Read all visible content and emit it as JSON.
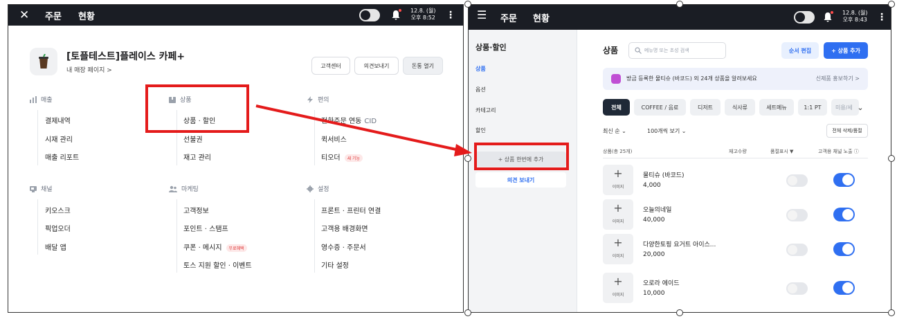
{
  "left_screen": {
    "topbar": {
      "order_label": "주문",
      "status_label": "현황",
      "date": "12.8. (월)",
      "time": "오후 8:52"
    },
    "store": {
      "name": "[토플테스트]플레이스 카페+",
      "sub_link": "내 매장 페이지 >"
    },
    "buttons": {
      "support": "고객센터",
      "feedback": "의견보내기",
      "open_drawer": "돈통 열기"
    },
    "categories": [
      {
        "title": "매출",
        "icon": "bar-chart-icon",
        "items": [
          "결제내역",
          "시재 관리",
          "매출 리포트"
        ]
      },
      {
        "title": "상품",
        "icon": "box-icon",
        "items": [
          "상품 · 할인",
          "선불권",
          "재고 관리"
        ]
      },
      {
        "title": "편의",
        "icon": "lightning-icon",
        "items": [
          "전화주문 연동",
          "퀵서비스",
          "티오더"
        ]
      },
      {
        "title": "채널",
        "icon": "kiosk-icon",
        "items": [
          "키오스크",
          "픽업오더",
          "배달 앱"
        ]
      },
      {
        "title": "마케팅",
        "icon": "people-icon",
        "items": [
          "고객정보",
          "포인트 · 스탬프",
          "쿠폰 · 메시지",
          "토스 지원 할인 · 이벤트"
        ]
      },
      {
        "title": "설정",
        "icon": "gear-icon",
        "items": [
          "프론트 · 프린터 연결",
          "고객용 배경화면",
          "영수증 · 주문서",
          "기타 설정"
        ]
      }
    ],
    "cid_label": "CID",
    "new_badge": "새 기능",
    "free_badge": "무료혜택"
  },
  "right_screen": {
    "topbar": {
      "order_label": "주문",
      "status_label": "현황",
      "date": "12.8. (월)",
      "time": "오후 8:43"
    },
    "sidebar": {
      "title": "상품·할인",
      "items": [
        "상품",
        "옵션",
        "카테고리",
        "할인"
      ],
      "add_bulk": "+ 상품 한번에 추가",
      "feedback": "의견 보내기"
    },
    "main": {
      "title": "상품",
      "search_placeholder": "메뉴명 또는 초성 검색",
      "order_edit": "순서 편집",
      "add_product": "+ 상품 추가",
      "promo_text": "방금 등록한 물티슈 (바코드) 외 24개 상품을 알려보세요",
      "promo_link": "신제품 홍보하기 >",
      "chips": [
        "전체",
        "COFFEE / 음료",
        "디저트",
        "식사류",
        "세트메뉴",
        "1:1 PT",
        "미용/세"
      ],
      "sort": "최신 순 ⌄",
      "page_size": "100개씩 보기 ⌄",
      "bulk_delete": "전체 삭제/품절",
      "headers": {
        "product_count": "상품(총 25개)",
        "stock": "재고수량",
        "soldout": "품절표시",
        "channel": "고객용 채널 노출"
      },
      "image_label": "이미지",
      "products": [
        {
          "name": "물티슈 (바코드)",
          "price": "4,000"
        },
        {
          "name": "오늘의네일",
          "price": "40,000"
        },
        {
          "name": "다양한토핑 요거트 아이스...",
          "price": "20,000"
        },
        {
          "name": "오로라 에이드",
          "price": "10,000"
        }
      ]
    }
  },
  "colors": {
    "topbar": "#1a1d24",
    "accent_blue": "#2f6ff1",
    "highlight_red": "#e41b1b"
  }
}
